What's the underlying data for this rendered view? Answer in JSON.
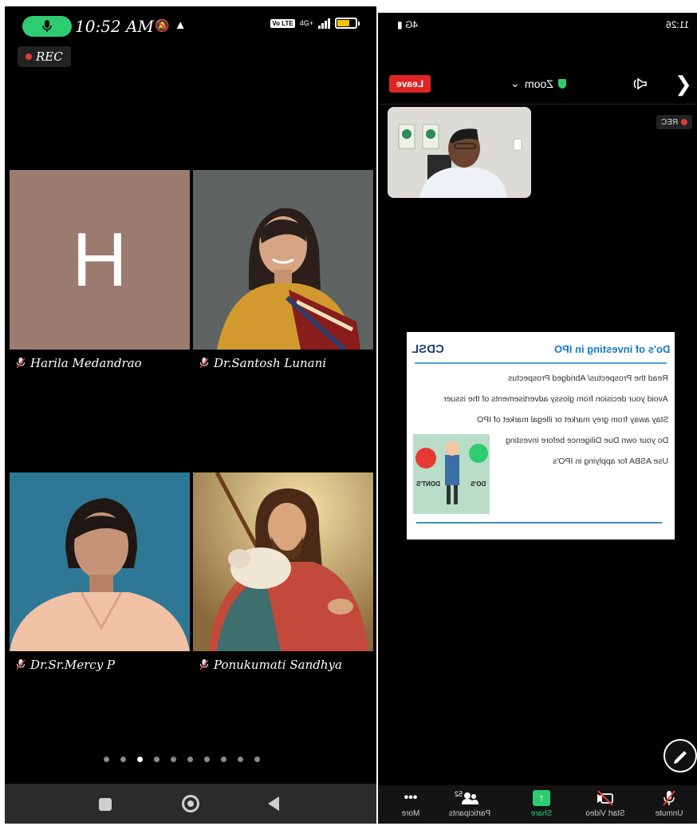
{
  "left_phone": {
    "status": {
      "time": "10:52 AM",
      "network": "4G+",
      "volte": "Vo LTE"
    },
    "rec_label": "REC",
    "tiles": [
      {
        "name": "Harila Medandrao",
        "avatar_letter": "H",
        "avatar_color": "#9b7b70",
        "muted": true
      },
      {
        "name": "Dr.Santosh Lunani",
        "muted": true
      },
      {
        "name": "Dr.Sr.Mercy P",
        "muted": true
      },
      {
        "name": "Ponukumati Sandhya",
        "muted": true
      }
    ],
    "page_dots": {
      "count": 10,
      "active_index": 2
    },
    "nav": [
      "recents-button",
      "home-button",
      "back-button"
    ]
  },
  "right_phone": {
    "mirrored": true,
    "status": {
      "time": "11:26",
      "signal_text": "4G"
    },
    "header": {
      "leave_label": "Leave",
      "meeting_title": "Zoom",
      "title_caret": "⌄"
    },
    "rec_label": "REC",
    "slide": {
      "title": "Do's of investing in IPO",
      "brand": "CDSL",
      "bullets": [
        "Read the Prospectus/ Abridged Prospectus",
        "Avoid your decision from glossy advertisements of the issuer",
        "Stay away from grey market or illegal market of IPO",
        "Do your own Due Diligence before investing",
        "Use ASBA for applying in IPO's"
      ],
      "dos_label": "DO'S",
      "donts_label": "DONT'S"
    },
    "toolbar": {
      "unmute": "Unmute",
      "start_video": "Start Video",
      "share": "Share",
      "participants": "Participants",
      "participants_count": "52",
      "more": "More"
    },
    "colors": {
      "leave": "#e02424",
      "share": "#2ecc71",
      "slide_title": "#1778c9"
    }
  }
}
